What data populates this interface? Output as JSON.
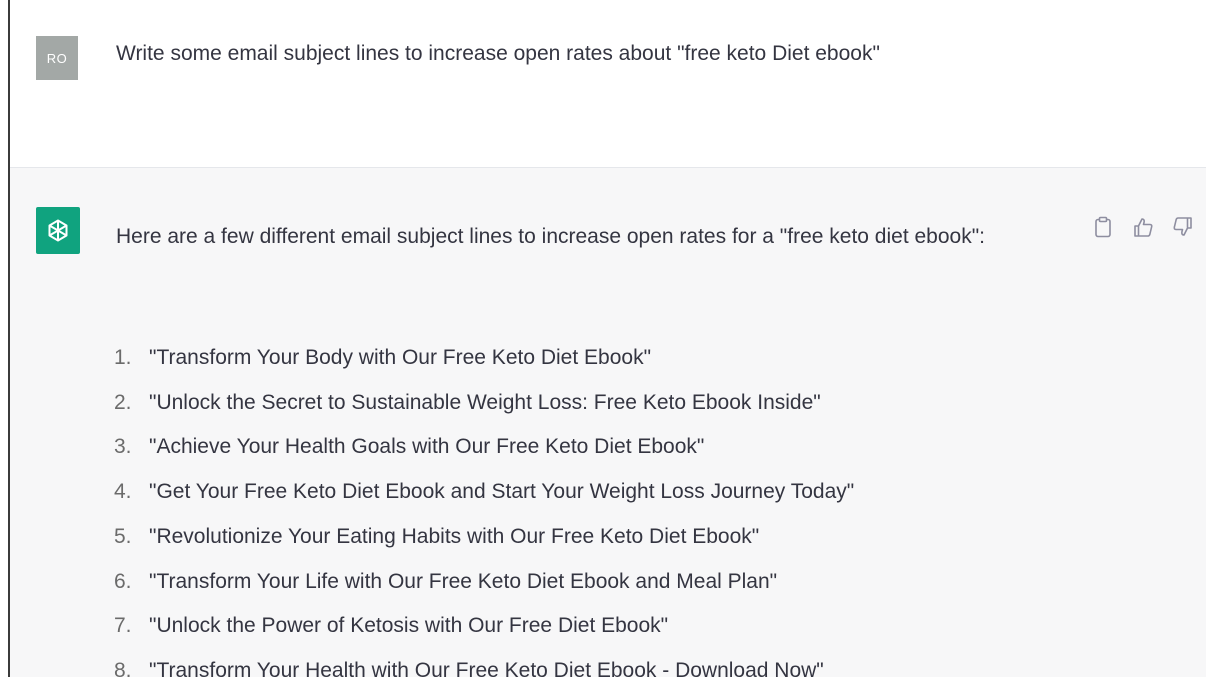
{
  "user_message": {
    "avatar_initials": "RO",
    "text": "Write some email subject lines to increase open rates about \"free keto Diet ebook\""
  },
  "assistant_message": {
    "avatar_icon": "openai-logo-icon",
    "intro": "Here are a few different email subject lines to increase open rates for a \"free keto diet ebook\":",
    "items": [
      {
        "num": "1.",
        "text": "\"Transform Your Body with Our Free Keto Diet Ebook\""
      },
      {
        "num": "2.",
        "text": "\"Unlock the Secret to Sustainable Weight Loss: Free Keto Ebook Inside\""
      },
      {
        "num": "3.",
        "text": "\"Achieve Your Health Goals with Our Free Keto Diet Ebook\""
      },
      {
        "num": "4.",
        "text": "\"Get Your Free Keto Diet Ebook and Start Your Weight Loss Journey Today\""
      },
      {
        "num": "5.",
        "text": "\"Revolutionize Your Eating Habits with Our Free Keto Diet Ebook\""
      },
      {
        "num": "6.",
        "text": "\"Transform Your Life with Our Free Keto Diet Ebook and Meal Plan\""
      },
      {
        "num": "7.",
        "text": "\"Unlock the Power of Ketosis with Our Free Diet Ebook\""
      },
      {
        "num": "8.",
        "text": "\"Transform Your Health with Our Free Keto Diet Ebook - Download Now\""
      }
    ],
    "actions": [
      "clipboard-icon",
      "thumbs-up-icon",
      "thumbs-down-icon"
    ]
  },
  "colors": {
    "user_avatar_bg": "#a3a8a6",
    "bot_avatar_bg": "#10a37f",
    "assistant_bg": "#f7f7f8",
    "text": "#343541"
  }
}
